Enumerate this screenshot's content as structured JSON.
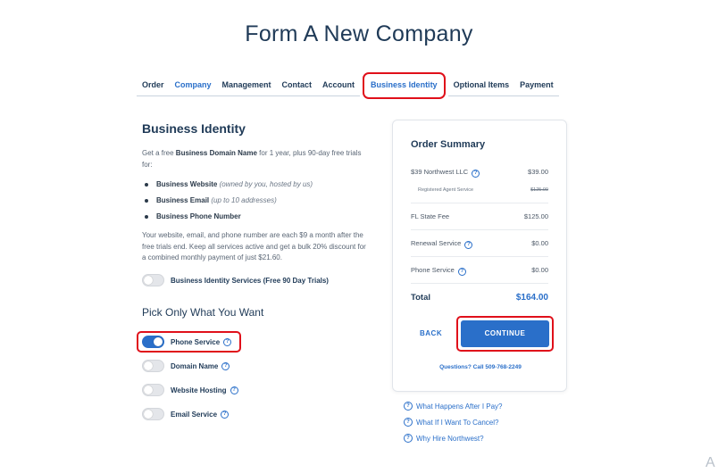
{
  "page_title": "Form A New Company",
  "tabs": [
    {
      "label": "Order"
    },
    {
      "label": "Company"
    },
    {
      "label": "Management"
    },
    {
      "label": "Contact"
    },
    {
      "label": "Account"
    },
    {
      "label": "Business Identity"
    },
    {
      "label": "Optional Items"
    },
    {
      "label": "Payment"
    }
  ],
  "left": {
    "title": "Business Identity",
    "intro_prefix": "Get a free ",
    "intro_bold": "Business Domain Name",
    "intro_suffix": " for 1 year, plus 90-day free trials for:",
    "bullets": [
      {
        "bold": "Business Website",
        "note": "(owned by you, hosted by us)"
      },
      {
        "bold": "Business Email",
        "note": "(up to 10 addresses)"
      },
      {
        "bold": "Business Phone Number",
        "note": ""
      }
    ],
    "description": "Your website, email, and phone number are each $9 a month after the free trials end. Keep all services active and get a bulk 20% discount for a combined monthly payment of just $21.60.",
    "master_toggle_label": "Business Identity Services (Free 90 Day Trials)",
    "pick_title": "Pick Only What You Want",
    "options": [
      {
        "label": "Phone Service",
        "on": true
      },
      {
        "label": "Domain Name",
        "on": false
      },
      {
        "label": "Website Hosting",
        "on": false
      },
      {
        "label": "Email Service",
        "on": false
      }
    ]
  },
  "summary": {
    "title": "Order Summary",
    "items": [
      {
        "label": "$39 Northwest LLC",
        "value": "$39.00"
      },
      {
        "label": "Registered Agent Service",
        "value": "$125.00"
      },
      {
        "label": "FL State Fee",
        "value": "$125.00"
      },
      {
        "label": "Renewal Service",
        "value": "$0.00"
      },
      {
        "label": "Phone Service",
        "value": "$0.00"
      }
    ],
    "total_label": "Total",
    "total_value": "$164.00",
    "back_label": "BACK",
    "continue_label": "CONTINUE",
    "questions": "Questions? Call 509-768-2249"
  },
  "faq": [
    {
      "label": "What Happens After I Pay?"
    },
    {
      "label": "What If I Want To Cancel?"
    },
    {
      "label": "Why Hire Northwest?"
    }
  ],
  "corner_glyph": "A",
  "colors": {
    "accent": "#2a6fc9",
    "highlight": "#e0101a",
    "navy": "#1f3a57"
  }
}
